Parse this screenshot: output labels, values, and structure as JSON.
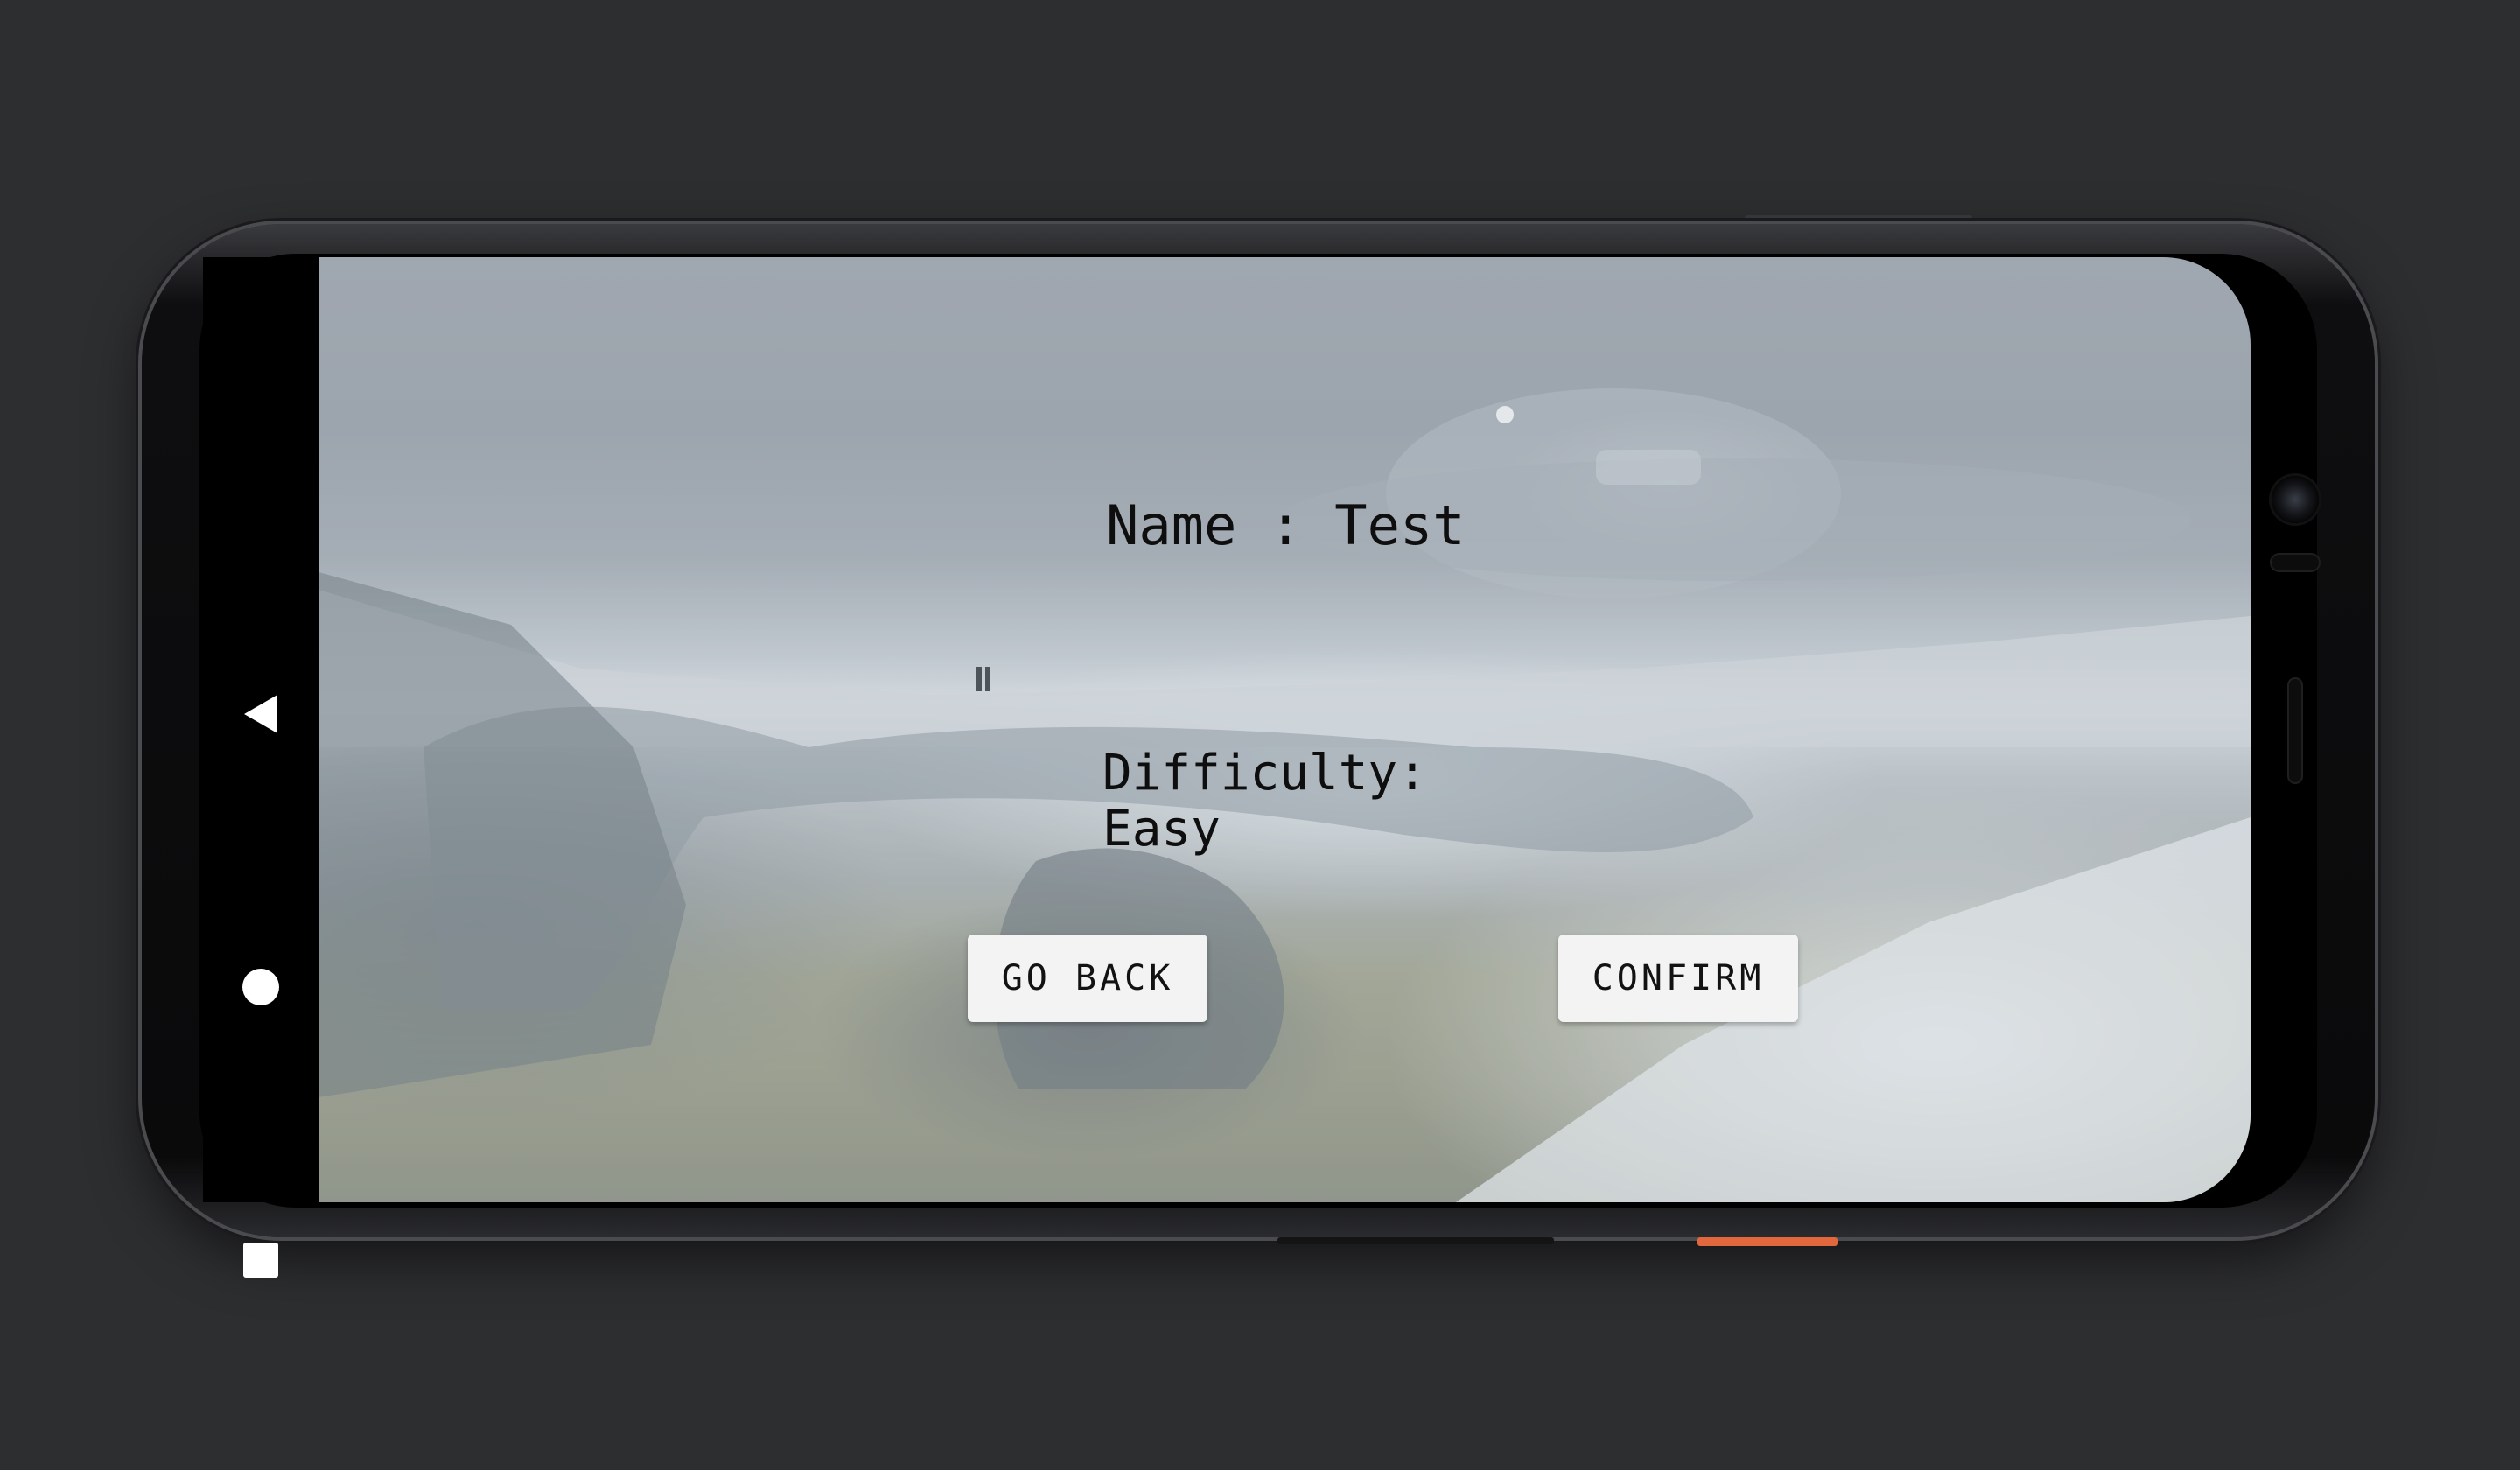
{
  "screen": {
    "name_line": "Name : Test",
    "difficulty_label": "Difficulty:",
    "difficulty_value": "Easy"
  },
  "buttons": {
    "go_back_label": "GO BACK",
    "confirm_label": "CONFIRM"
  },
  "navbar": {
    "back_icon": "back-triangle-icon",
    "home_icon": "home-circle-icon",
    "recents_icon": "recents-square-icon"
  },
  "colors": {
    "background": "#2d2e30",
    "button_bg": "#f3f3f3",
    "text": "#0e0e0e",
    "power_button": "#e2673d"
  }
}
